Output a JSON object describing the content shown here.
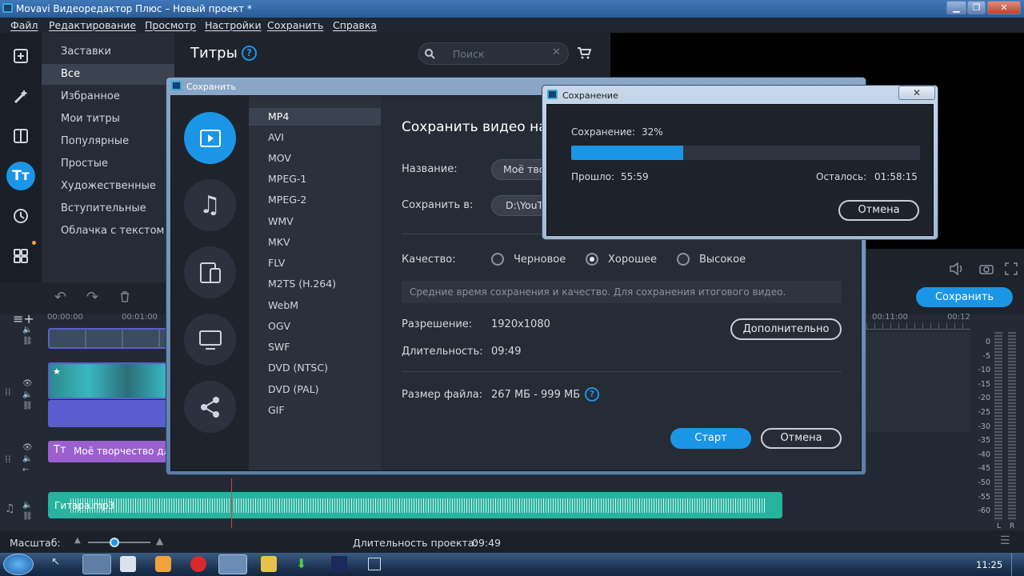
{
  "window": {
    "title": "Movavi Видеоредактор Плюс – Новый проект *"
  },
  "menu": [
    "Файл",
    "Редактирование",
    "Просмотр",
    "Настройки",
    "Сохранить",
    "Справка"
  ],
  "categories": {
    "items": [
      "Заставки",
      "Все",
      "Избранное",
      "Мои титры",
      "Популярные",
      "Простые",
      "Художественные",
      "Вступительные",
      "Облачка с текстом"
    ],
    "selected": "Все"
  },
  "titles_panel": {
    "header": "Титры",
    "search_placeholder": "Поиск"
  },
  "save_dialog": {
    "title": "Сохранить",
    "heading": "Сохранить видео на",
    "formats": [
      "MP4",
      "AVI",
      "MOV",
      "MPEG-1",
      "MPEG-2",
      "WMV",
      "MKV",
      "FLV",
      "M2TS (H.264)",
      "WebM",
      "OGV",
      "SWF",
      "DVD (NTSC)",
      "DVD (PAL)",
      "GIF"
    ],
    "selected_format": "MP4",
    "name_label": "Название:",
    "name_value": "Моё творчество",
    "save_to_label": "Сохранить в:",
    "save_to_value": "D:\\YouTube",
    "quality_label": "Качество:",
    "quality_options": [
      "Черновое",
      "Хорошее",
      "Высокое"
    ],
    "quality_selected": "Хорошее",
    "quality_hint": "Средние время сохранения и качество. Для сохранения итогового видео.",
    "resolution_label": "Разрешение:",
    "resolution_value": "1920x1080",
    "advanced_button": "Дополнительно",
    "duration_label": "Длительность:",
    "duration_value": "09:49",
    "filesize_label": "Размер файла:",
    "filesize_value": "267 МБ - 999 МБ",
    "start_button": "Старт",
    "cancel_button": "Отмена"
  },
  "progress_dialog": {
    "title": "Сохранение",
    "status_label": "Сохранение:",
    "percent_text": "32%",
    "progress": 0.32,
    "elapsed_label": "Прошло:",
    "elapsed_value": "55:59",
    "remaining_label": "Осталось:",
    "remaining_value": "01:58:15",
    "cancel_button": "Отмена"
  },
  "timeline": {
    "ruler_left": [
      "00:00:00",
      "00:01:00"
    ],
    "ruler_right": [
      "00:11:00",
      "00:12"
    ],
    "save_button": "Сохранить",
    "title_clip": "Моё творчество дл",
    "audio_clip": "Гитара.mp3",
    "meter_labels": [
      "0",
      "-5",
      "-10",
      "-15",
      "-20",
      "-25",
      "-30",
      "-35",
      "-40",
      "-45",
      "-50",
      "-55",
      "-60"
    ],
    "meter_channels": [
      "L",
      "R"
    ]
  },
  "status": {
    "scale_label": "Масштаб:",
    "duration_label": "Длительность проекта:",
    "duration_value": "09:49"
  },
  "taskbar": {
    "clock": "11:25"
  },
  "colors": {
    "accent": "#1b95e6",
    "title_clip": "#9b5fd0",
    "audio_clip": "#27b3a0",
    "video_track": "#5a5fcf"
  }
}
